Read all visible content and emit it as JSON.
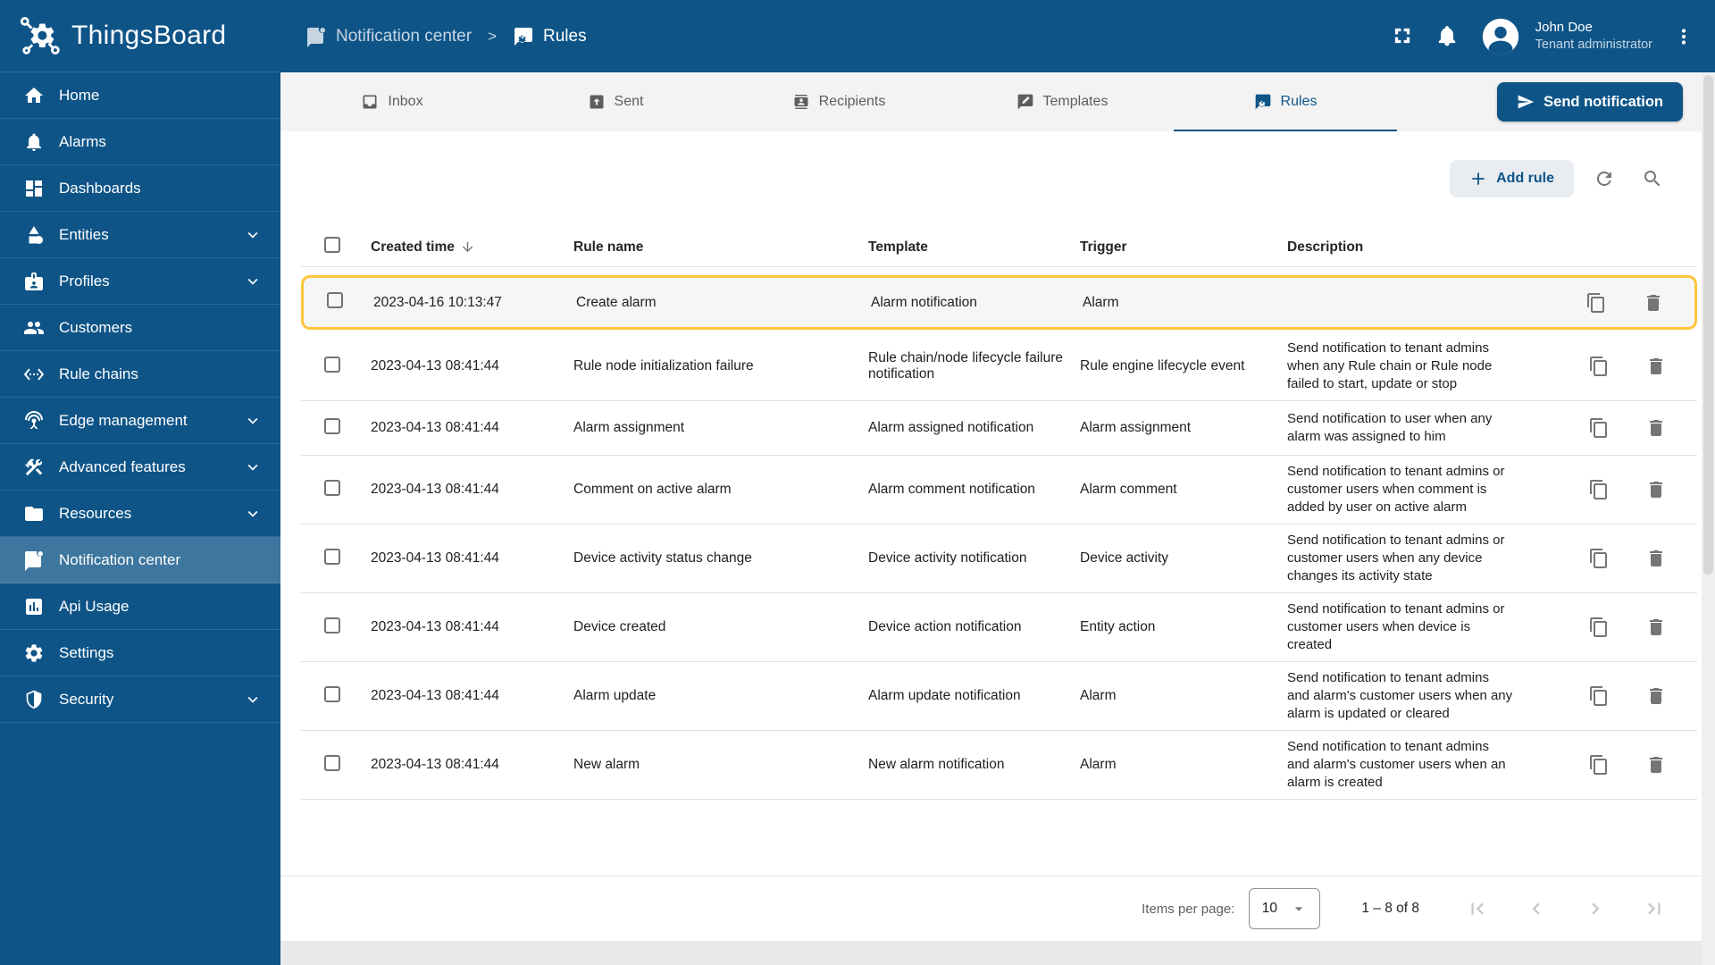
{
  "app": {
    "name": "ThingsBoard"
  },
  "breadcrumb": {
    "section": "Notification center",
    "separator": ">",
    "page": "Rules"
  },
  "header": {
    "user": {
      "name": "John Doe",
      "role": "Tenant administrator"
    }
  },
  "sidebar": {
    "items": [
      {
        "label": "Home",
        "icon": "home"
      },
      {
        "label": "Alarms",
        "icon": "alarms"
      },
      {
        "label": "Dashboards",
        "icon": "dashboards"
      },
      {
        "label": "Entities",
        "icon": "entities",
        "expandable": true
      },
      {
        "label": "Profiles",
        "icon": "profiles",
        "expandable": true
      },
      {
        "label": "Customers",
        "icon": "customers"
      },
      {
        "label": "Rule chains",
        "icon": "rule-chains"
      },
      {
        "label": "Edge management",
        "icon": "edge-management",
        "expandable": true
      },
      {
        "label": "Advanced features",
        "icon": "advanced-features",
        "expandable": true
      },
      {
        "label": "Resources",
        "icon": "resources",
        "expandable": true
      },
      {
        "label": "Notification center",
        "icon": "notification-center",
        "selected": true
      },
      {
        "label": "Api Usage",
        "icon": "api-usage"
      },
      {
        "label": "Settings",
        "icon": "settings"
      },
      {
        "label": "Security",
        "icon": "security",
        "expandable": true
      }
    ]
  },
  "tabs": {
    "items": [
      {
        "label": "Inbox",
        "icon": "inbox"
      },
      {
        "label": "Sent",
        "icon": "sent"
      },
      {
        "label": "Recipients",
        "icon": "recipients"
      },
      {
        "label": "Templates",
        "icon": "templates"
      },
      {
        "label": "Rules",
        "icon": "rules",
        "active": true
      }
    ]
  },
  "actions": {
    "send_notification": "Send notification",
    "add_rule": "Add rule"
  },
  "table": {
    "columns": [
      "Created time",
      "Rule name",
      "Template",
      "Trigger",
      "Description"
    ],
    "rows": [
      {
        "created": "2023-04-16 10:13:47",
        "name": "Create alarm",
        "template": "Alarm notification",
        "trigger": "Alarm",
        "description": "",
        "highlighted": true
      },
      {
        "created": "2023-04-13 08:41:44",
        "name": "Rule node initialization failure",
        "template": "Rule chain/node lifecycle failure notification",
        "trigger": "Rule engine lifecycle event",
        "description": "Send notification to tenant admins when any Rule chain or Rule node failed to start, update or stop"
      },
      {
        "created": "2023-04-13 08:41:44",
        "name": "Alarm assignment",
        "template": "Alarm assigned notification",
        "trigger": "Alarm assignment",
        "description": "Send notification to user when any alarm was assigned to him"
      },
      {
        "created": "2023-04-13 08:41:44",
        "name": "Comment on active alarm",
        "template": "Alarm comment notification",
        "trigger": "Alarm comment",
        "description": "Send notification to tenant admins or customer users when comment is added by user on active alarm"
      },
      {
        "created": "2023-04-13 08:41:44",
        "name": "Device activity status change",
        "template": "Device activity notification",
        "trigger": "Device activity",
        "description": "Send notification to tenant admins or customer users when any device changes its activity state"
      },
      {
        "created": "2023-04-13 08:41:44",
        "name": "Device created",
        "template": "Device action notification",
        "trigger": "Entity action",
        "description": "Send notification to tenant admins or customer users when device is created"
      },
      {
        "created": "2023-04-13 08:41:44",
        "name": "Alarm update",
        "template": "Alarm update notification",
        "trigger": "Alarm",
        "description": "Send notification to tenant admins and alarm's customer users when any alarm is updated or cleared"
      },
      {
        "created": "2023-04-13 08:41:44",
        "name": "New alarm",
        "template": "New alarm notification",
        "trigger": "Alarm",
        "description": "Send notification to tenant admins and alarm's customer users when an alarm is created"
      }
    ]
  },
  "pagination": {
    "label": "Items per page:",
    "per_page": "10",
    "range": "1 – 8 of 8"
  },
  "colors": {
    "primary": "#0e5487",
    "sidebar_selected": "#3d769e",
    "highlight_border": "#ffc53d"
  }
}
